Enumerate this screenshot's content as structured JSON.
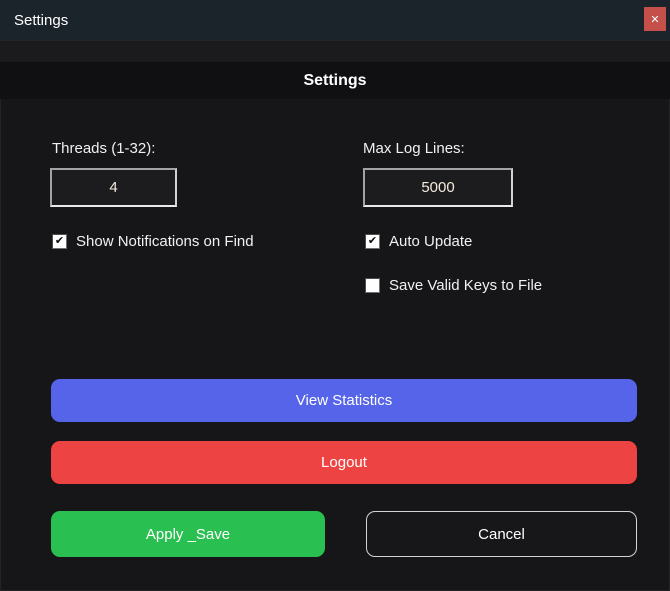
{
  "window": {
    "title": "Settings",
    "close_glyph": "✕"
  },
  "header": {
    "title": "Settings"
  },
  "fields": {
    "threads": {
      "label": "Threads (1-32):",
      "value": "4"
    },
    "max_log_lines": {
      "label": "Max Log Lines:",
      "value": "5000"
    }
  },
  "checkboxes": {
    "show_notifications": {
      "label": "Show Notifications on Find",
      "checked": true,
      "glyph": "✔"
    },
    "auto_update": {
      "label": "Auto Update",
      "checked": true,
      "glyph": "✔"
    },
    "save_valid_keys": {
      "label": "Save Valid Keys to File",
      "checked": false,
      "glyph": ""
    }
  },
  "buttons": {
    "view_statistics": "View Statistics",
    "logout": "Logout",
    "apply_save": "Apply _Save",
    "cancel": "Cancel"
  },
  "colors": {
    "titlebar_bg": "#1b232b",
    "close_button_bg": "#c45049",
    "header_strip_bg": "#101013",
    "window_bg": "#161619",
    "view_statistics_bg": "#5564e8",
    "logout_bg": "#ee4343",
    "apply_save_bg": "#2abf51",
    "cancel_border": "#d4d4d4",
    "input_bg": "#1c1c1f"
  }
}
